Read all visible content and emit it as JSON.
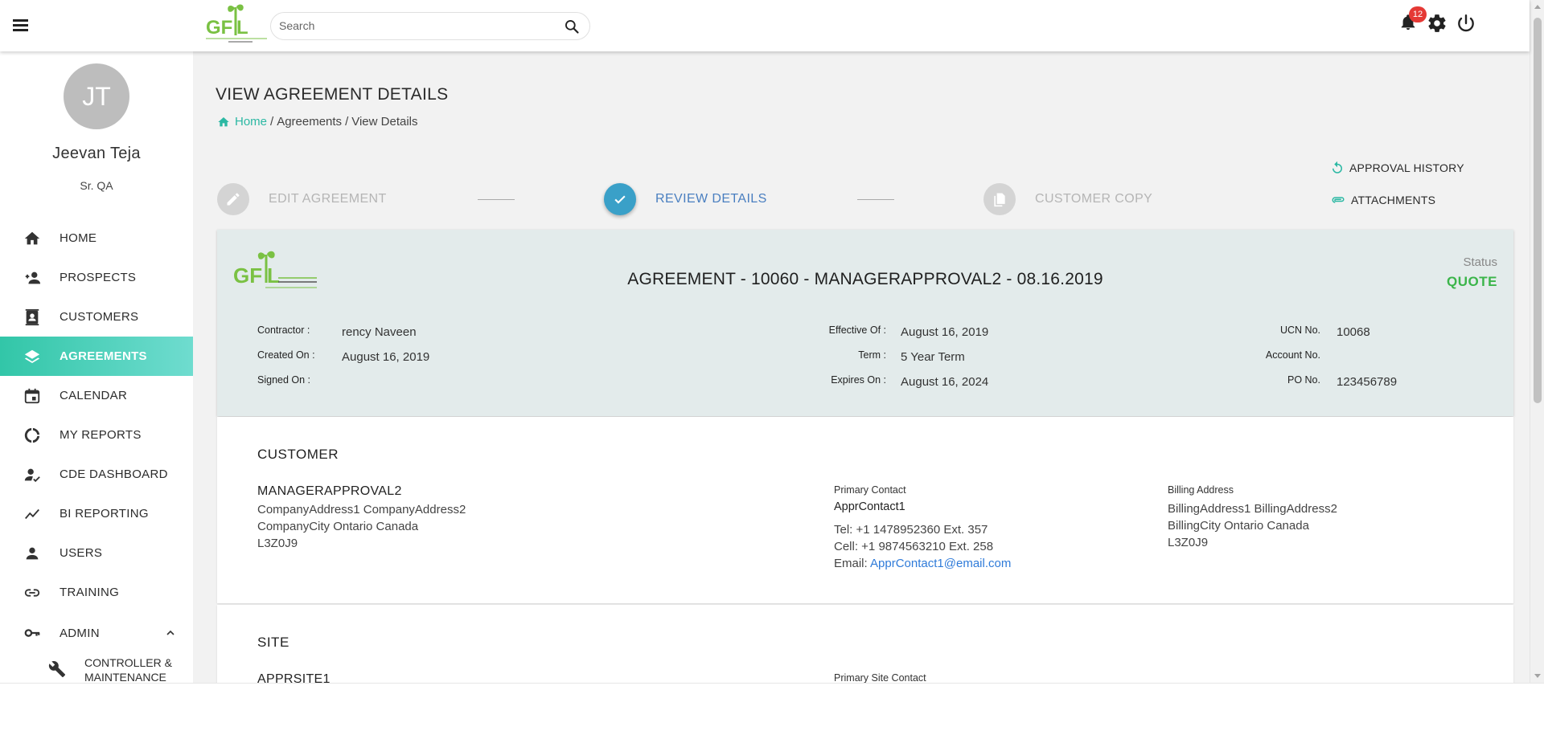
{
  "topbar": {
    "search_placeholder": "Search",
    "notification_count": "12",
    "icons": [
      "menu-icon",
      "search-icon",
      "bell-icon",
      "gear-icon",
      "power-icon"
    ]
  },
  "user": {
    "initials": "JT",
    "name": "Jeevan Teja",
    "role": "Sr. QA"
  },
  "sidebar": {
    "items": [
      {
        "label": "HOME",
        "icon": "home-icon"
      },
      {
        "label": "PROSPECTS",
        "icon": "person-add-icon"
      },
      {
        "label": "CUSTOMERS",
        "icon": "contacts-icon"
      },
      {
        "label": "AGREEMENTS",
        "icon": "layers-icon",
        "active": true
      },
      {
        "label": "CALENDAR",
        "icon": "calendar-icon"
      },
      {
        "label": "MY REPORTS",
        "icon": "report-ring-icon"
      },
      {
        "label": "CDE DASHBOARD",
        "icon": "person-check-icon"
      },
      {
        "label": "BI REPORTING",
        "icon": "trend-icon"
      },
      {
        "label": "USERS",
        "icon": "person-icon"
      },
      {
        "label": "TRAINING",
        "icon": "link-icon"
      },
      {
        "label": "ADMIN",
        "icon": "key-icon"
      }
    ],
    "admin_sub": {
      "label": "CONTROLLER & MAINTENANCE",
      "icon": "wrench-icon"
    }
  },
  "page": {
    "title": "VIEW AGREEMENT DETAILS",
    "breadcrumb": {
      "home": "Home",
      "sep1": "/",
      "level2": "Agreements",
      "sep2": "/",
      "level3": "View Details"
    }
  },
  "stepper": {
    "steps": [
      {
        "label": "EDIT AGREEMENT",
        "icon": "pencil-icon",
        "state": "inactive"
      },
      {
        "label": "REVIEW DETAILS",
        "icon": "check-icon",
        "state": "active"
      },
      {
        "label": "CUSTOMER COPY",
        "icon": "copy-icon",
        "state": "inactive"
      }
    ]
  },
  "side_links": {
    "approval_history": "APPROVAL HISTORY",
    "attachments": "ATTACHMENTS"
  },
  "agreement": {
    "title": "AGREEMENT - 10060 - MANAGERAPPROVAL2 - 08.16.2019",
    "status_label": "Status",
    "status_value": "QUOTE",
    "status_color": "#3bb54a",
    "contractor_key": "Contractor :",
    "contractor": "rency Naveen",
    "created_on_key": "Created On :",
    "created_on": "August 16, 2019",
    "signed_on_key": "Signed On :",
    "signed_on": "",
    "effective_of_key": "Effective Of :",
    "effective_of": "August 16, 2019",
    "term_key": "Term :",
    "term": "5 Year Term",
    "expires_on_key": "Expires On :",
    "expires_on": "August 16, 2024",
    "ucn_key": "UCN No.",
    "ucn": "10068",
    "account_key": "Account No.",
    "account": "",
    "po_key": "PO No.",
    "po": "123456789"
  },
  "customer": {
    "section_title": "CUSTOMER",
    "name": "MANAGERAPPROVAL2",
    "address1": "CompanyAddress1 CompanyAddress2",
    "address2": "CompanyCity Ontario Canada",
    "postal": "L3Z0J9",
    "primary_contact_key": "Primary Contact",
    "primary_contact": "ApprContact1",
    "tel": "Tel: +1 1478952360 Ext. 357",
    "cell": "Cell: +1 9874563210 Ext. 258",
    "email_prefix": "Email:",
    "email": "ApprContact1@email.com",
    "billing_key": "Billing Address",
    "billing1": "BillingAddress1 BillingAddress2",
    "billing2": "BillingCity Ontario Canada",
    "billing_postal": "L3Z0J9"
  },
  "site": {
    "section_title": "SITE",
    "name": "APPRSITE1",
    "primary_site_contact_key": "Primary Site Contact"
  },
  "colors": {
    "accent": "#32c6a8",
    "stepper_active": "#3aa0c8",
    "link": "#2f7bd9",
    "badge": "#e53935"
  }
}
